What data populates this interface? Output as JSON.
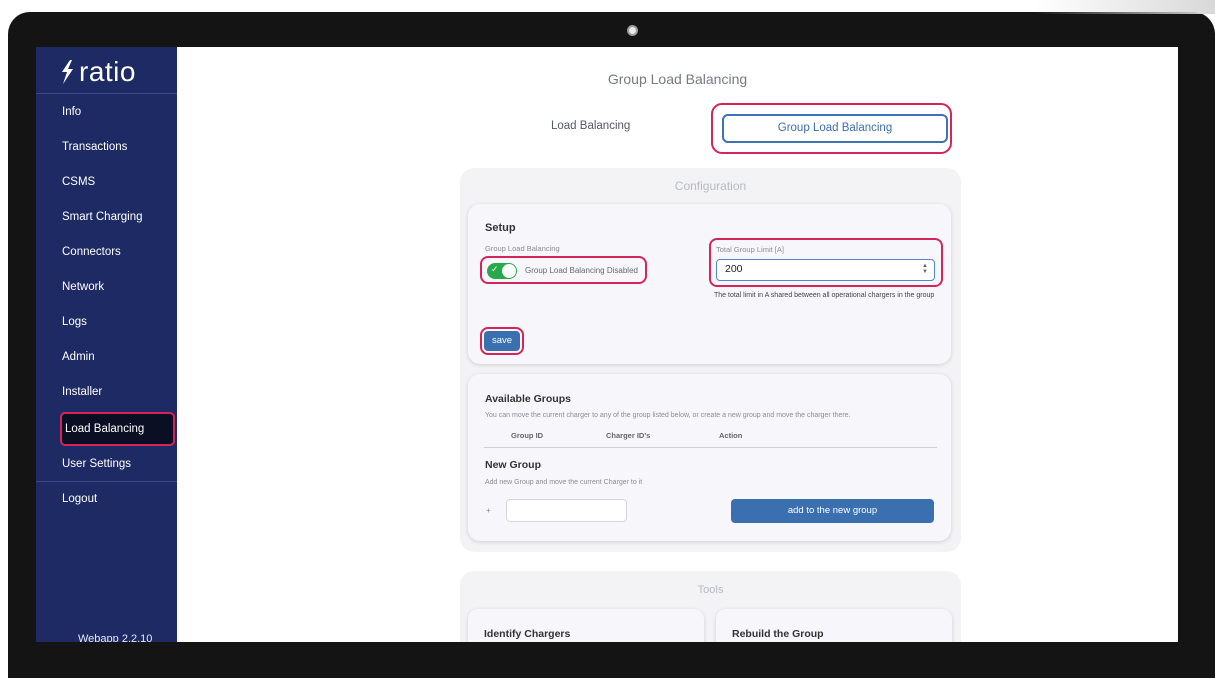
{
  "sidebar": {
    "logo": "ratio",
    "items": [
      {
        "label": "Info"
      },
      {
        "label": "Transactions"
      },
      {
        "label": "CSMS"
      },
      {
        "label": "Smart Charging"
      },
      {
        "label": "Connectors"
      },
      {
        "label": "Network"
      },
      {
        "label": "Logs"
      },
      {
        "label": "Admin"
      },
      {
        "label": "Installer"
      },
      {
        "label": "Load Balancing"
      },
      {
        "label": "User Settings"
      },
      {
        "label": "Logout"
      }
    ],
    "active_item": "Load Balancing",
    "version": "Webapp 2.2.10"
  },
  "main": {
    "title": "Group Load Balancing",
    "tabs": [
      {
        "label": "Load Balancing",
        "active": false
      },
      {
        "label": "Group Load Balancing",
        "active": true
      }
    ]
  },
  "configuration": {
    "title": "Configuration",
    "setup": {
      "heading": "Setup",
      "toggle_label": "Group Load Balancing",
      "toggle_state_text": "Group Load Balancing Disabled",
      "toggle_checkmark": "✓",
      "limit_label": "Total Group Limit [A]",
      "limit_value": "200",
      "limit_help": "The total limit in A shared between all operational chargers in the group",
      "save_label": "save"
    },
    "groups": {
      "heading": "Available Groups",
      "description": "You can move the current charger to any of the group listed below, or create a new group and move the charger there.",
      "columns": [
        "Group ID",
        "Charger ID's",
        "Action"
      ],
      "new_group_heading": "New Group",
      "new_group_description": "Add new Group and move the current Charger to it",
      "plus_symbol": "+",
      "new_group_value": "",
      "add_button_label": "add to the new group"
    }
  },
  "tools": {
    "title": "Tools",
    "cards": [
      {
        "title": "Identify Chargers"
      },
      {
        "title": "Rebuild the Group"
      }
    ]
  },
  "colors": {
    "sidebar_bg": "#1e2a64",
    "accent_blue": "#3a6fb0",
    "highlight_red": "#d6245a",
    "toggle_green": "#27a84a"
  }
}
